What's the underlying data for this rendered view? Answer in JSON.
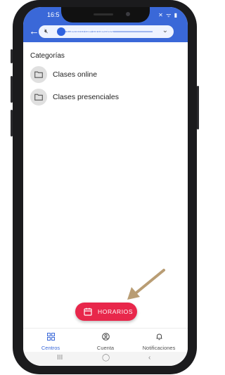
{
  "status_bar": {
    "time": "16:5",
    "icons": "✕ ᯤ ▮"
  },
  "header": {
    "back_icon": "back-arrow-icon",
    "selector_value": "Centro de pruebas",
    "mute_icon": "mute-icon",
    "dropdown_icon": "chevron-down-icon",
    "color": "#3a68d8"
  },
  "main": {
    "section_title": "Categorías",
    "categories": [
      {
        "label": "Clases online",
        "icon": "folder-icon"
      },
      {
        "label": "Clases presenciales",
        "icon": "folder-icon"
      }
    ]
  },
  "fab": {
    "label": "HORARIOS",
    "icon": "calendar-icon",
    "color": "#e8274b"
  },
  "bottom_nav": {
    "items": [
      {
        "label": "Centros",
        "icon": "grid-icon",
        "active": true
      },
      {
        "label": "Cuenta",
        "icon": "account-icon",
        "active": false
      },
      {
        "label": "Notificaciones",
        "icon": "bell-icon",
        "active": false
      }
    ],
    "active_color": "#3a68d8"
  },
  "system_nav": {
    "recents": "III",
    "home": "◯",
    "back": "‹"
  }
}
